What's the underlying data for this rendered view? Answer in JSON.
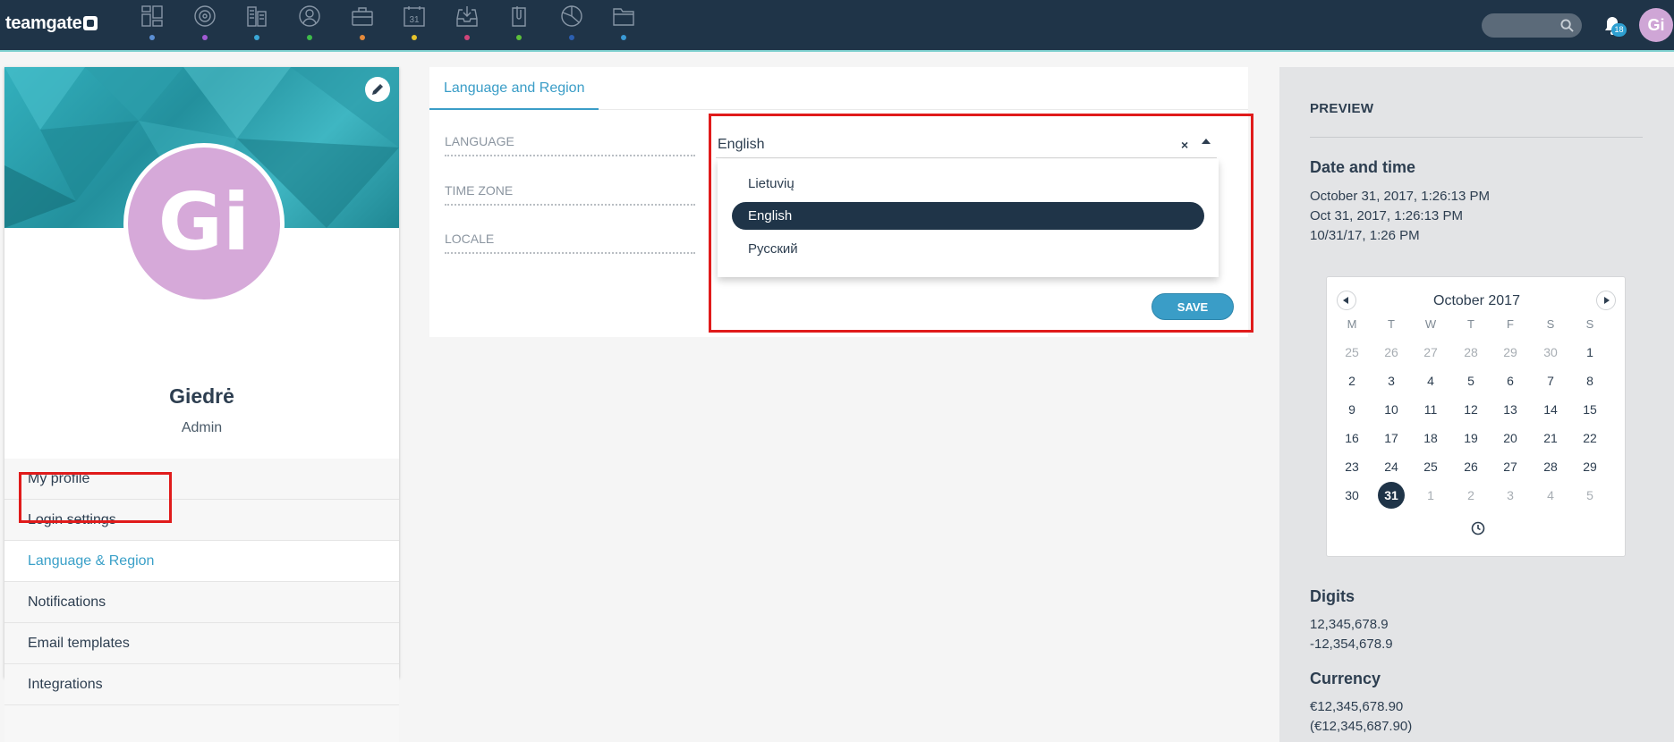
{
  "app": {
    "logo_text": "teamgate",
    "notifications_count": "18",
    "avatar_initials": "Gi"
  },
  "nav": {
    "icons": [
      {
        "name": "dashboard-icon",
        "color": "#5b8fd4"
      },
      {
        "name": "target-icon",
        "color": "#a15bd4"
      },
      {
        "name": "companies-icon",
        "color": "#3aa7d6"
      },
      {
        "name": "contacts-icon",
        "color": "#3dbb4a"
      },
      {
        "name": "deals-icon",
        "color": "#e58a3b"
      },
      {
        "name": "calendar-icon",
        "color": "#e6c32b"
      },
      {
        "name": "inbox-icon",
        "color": "#d0457a"
      },
      {
        "name": "attachments-icon",
        "color": "#5cbf3a"
      },
      {
        "name": "reports-icon",
        "color": "#2b5fb0"
      },
      {
        "name": "files-icon",
        "color": "#3a9ad6"
      }
    ],
    "calendar_day": "31"
  },
  "profile": {
    "initials": "Gi",
    "name": "Giedrė",
    "role": "Admin",
    "menu": [
      {
        "label": "My profile"
      },
      {
        "label": "Login settings"
      },
      {
        "label": "Language & Region"
      },
      {
        "label": "Notifications"
      },
      {
        "label": "Email templates"
      },
      {
        "label": "Integrations"
      }
    ],
    "active_menu": "Language & Region"
  },
  "settings": {
    "tab": "Language and Region",
    "fields": {
      "language": "LANGUAGE",
      "time_zone": "TIME ZONE",
      "locale": "LOCALE"
    },
    "language_value": "English",
    "clear_label": "×",
    "options": [
      "Lietuvių",
      "English",
      "Русский"
    ],
    "selected_option": "English",
    "save_label": "SAVE"
  },
  "preview": {
    "heading": "PREVIEW",
    "date_title": "Date and time",
    "dates": [
      "October 31, 2017, 1:26:13 PM",
      "Oct 31, 2017, 1:26:13 PM",
      "10/31/17, 1:26 PM"
    ],
    "calendar": {
      "month": "October 2017",
      "dow": [
        "M",
        "T",
        "W",
        "T",
        "F",
        "S",
        "S"
      ],
      "weeks": [
        [
          "25",
          "26",
          "27",
          "28",
          "29",
          "30",
          "1"
        ],
        [
          "2",
          "3",
          "4",
          "5",
          "6",
          "7",
          "8"
        ],
        [
          "9",
          "10",
          "11",
          "12",
          "13",
          "14",
          "15"
        ],
        [
          "16",
          "17",
          "18",
          "19",
          "20",
          "21",
          "22"
        ],
        [
          "23",
          "24",
          "25",
          "26",
          "27",
          "28",
          "29"
        ],
        [
          "30",
          "31",
          "1",
          "2",
          "3",
          "4",
          "5"
        ]
      ],
      "selected_day": "31"
    },
    "digits_title": "Digits",
    "digits": [
      "12,345,678.9",
      "-12,354,678.9"
    ],
    "currency_title": "Currency",
    "currency": [
      "€12,345,678.90",
      "(€12,345,687.90)"
    ]
  },
  "colors": {
    "topbar": "#1f3448",
    "accent": "#3a9dc7",
    "highlight_box": "#e01b1b"
  }
}
